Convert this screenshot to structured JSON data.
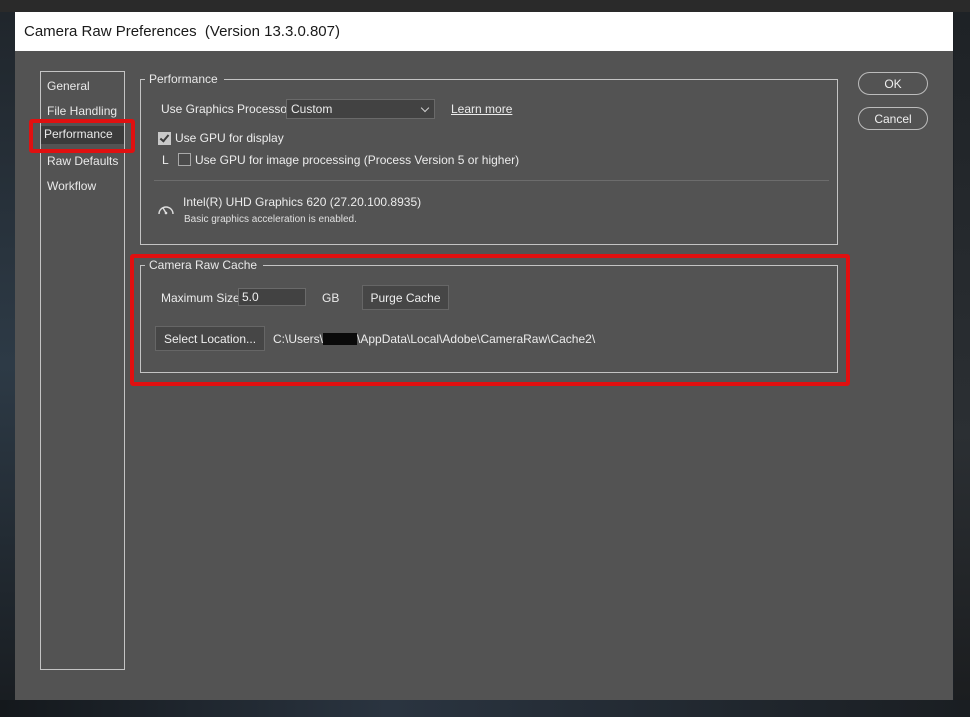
{
  "window": {
    "title": "Camera Raw Preferences  (Version 13.3.0.807)"
  },
  "nav": {
    "items": [
      {
        "label": "General"
      },
      {
        "label": "File Handling"
      },
      {
        "label": "Performance"
      },
      {
        "label": "Raw Defaults"
      },
      {
        "label": "Workflow"
      }
    ],
    "selected": "Performance"
  },
  "performance": {
    "legend": "Performance",
    "gpu_label": "Use Graphics Processor:",
    "gpu_value": "Custom",
    "learn_more": "Learn more",
    "display_label": "Use GPU for display",
    "display_checked": true,
    "processing_prefix": "L",
    "processing_label": "Use GPU for image processing (Process Version 5 or higher)",
    "processing_checked": false,
    "gpu_name": "Intel(R) UHD Graphics 620 (27.20.100.8935)",
    "gpu_status": "Basic graphics acceleration is enabled.",
    "gauge_icon": "speedometer-icon"
  },
  "cache": {
    "legend": "Camera Raw Cache",
    "max_size_label": "Maximum Size:",
    "max_size_value": "5.0",
    "unit": "GB",
    "purge_label": "Purge Cache",
    "select_location_label": "Select Location...",
    "path_prefix": "C:\\Users\\",
    "path_suffix": "\\AppData\\Local\\Adobe\\CameraRaw\\Cache2\\"
  },
  "buttons": {
    "ok": "OK",
    "cancel": "Cancel"
  },
  "colors": {
    "dialog_bg": "#535353",
    "highlight": "#e01010",
    "titlebar": "#ffffff"
  }
}
